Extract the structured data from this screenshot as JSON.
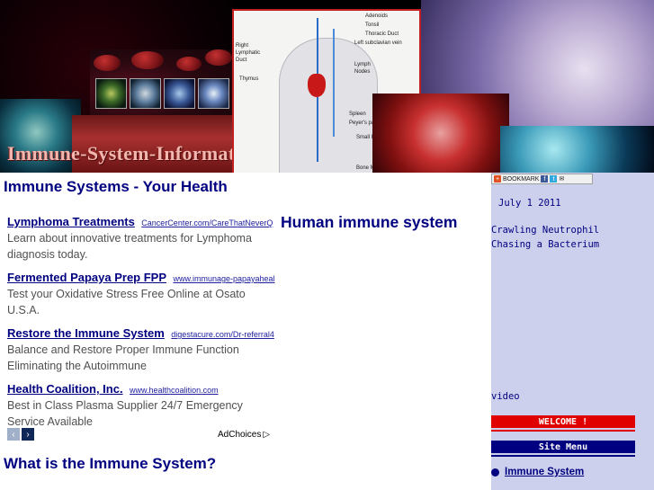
{
  "banner": {
    "site_title": "Immune-System-Information.com",
    "anatomy_labels": [
      "Adenoids",
      "Tonsil",
      "Thoracic Duct",
      "Left subclavian vein",
      "Right Lymphatic Duct",
      "Thymus",
      "Lymph Nodes",
      "Spleen",
      "Peyer's patch",
      "Small I",
      "Bone M"
    ]
  },
  "main": {
    "page_heading": "Immune Systems - Your Health",
    "section_title": "Human immune system",
    "section_title_2": "What is the Immune System?",
    "ads": [
      {
        "title": "Lymphoma Treatments",
        "url": "CancerCenter.com/CareThatNeverQ",
        "desc": "Learn about innovative treatments for Lymphoma diagnosis today."
      },
      {
        "title": "Fermented Papaya Prep FPP",
        "url": "www.immunage-papayaheal",
        "desc": "Test your Oxidative Stress Free Online at Osato U.S.A."
      },
      {
        "title": "Restore the Immune System",
        "url": "digestacure.com/Dr-referral4",
        "desc": "Balance and Restore Proper Immune Function Eliminating the Autoimmune"
      },
      {
        "title": "Health Coalition, Inc.",
        "url": "www.healthcoalition.com",
        "desc": "Best in Class Plasma Supplier 24/7 Emergency Service Available"
      }
    ],
    "adchoices_label": "AdChoices",
    "nav_prev": "‹",
    "nav_next": "›"
  },
  "sidebar": {
    "bookmark_label": "BOOKMARK",
    "date": "July 1 2011",
    "caption": "Crawling Neutrophil\nChasing a Bacterium",
    "video_label": "video",
    "welcome_label": "WELCOME !",
    "site_menu_label": "Site Menu",
    "menu_items": [
      {
        "label": "Immune System"
      }
    ]
  },
  "colors": {
    "heading": "#000080",
    "sidebar_bg": "#ccd0ec",
    "welcome_bar": "#e00000",
    "menu_bar": "#000080"
  }
}
